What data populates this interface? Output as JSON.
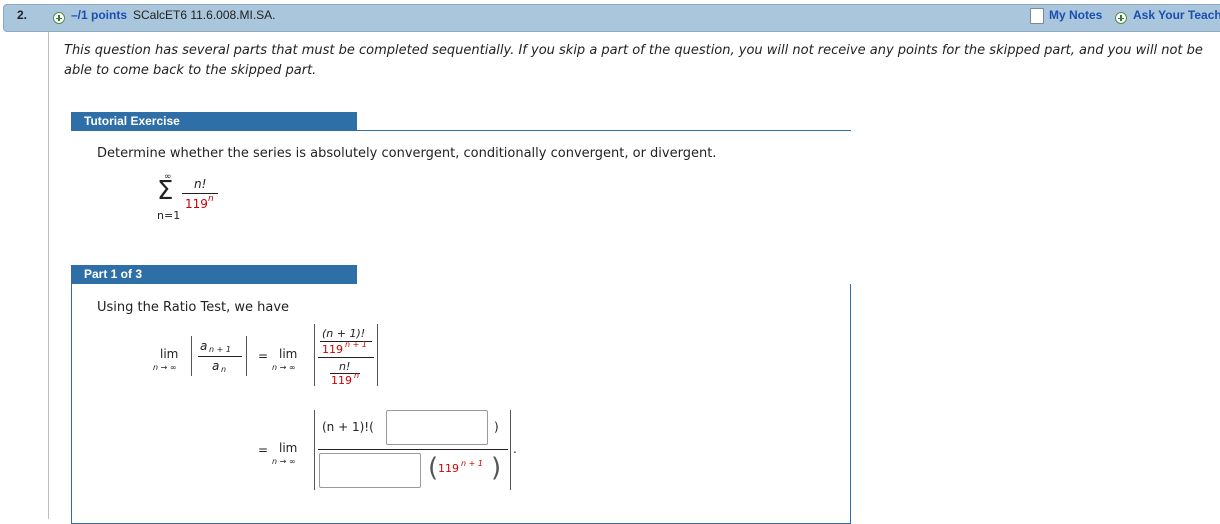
{
  "header": {
    "number": "2.",
    "points": "–/1 points",
    "question_id": "SCalcET6 11.6.008.MI.SA.",
    "my_notes": "My Notes",
    "ask_teacher": "Ask Your Teacher"
  },
  "intro": "This question has several parts that must be completed sequentially. If you skip a part of the question, you will not receive any points for the skipped part, and you will not be able to come back to the skipped part.",
  "tutorial": {
    "tab": "Tutorial Exercise",
    "prompt": "Determine whether the series is absolutely convergent, conditionally convergent, or divergent.",
    "series": {
      "upper": "∞",
      "sigma": "Σ",
      "lower": "n=1",
      "numerator": "n!",
      "denominator_base": "119",
      "denominator_exp": "n"
    }
  },
  "part1": {
    "tab": "Part 1 of 3",
    "text": "Using the Ratio Test, we have",
    "lim": "lim",
    "lim_sub": "n → ∞",
    "a_num": "a",
    "a_num_sub": "n + 1",
    "a_den": "a",
    "a_den_sub": "n",
    "eq": "=",
    "big_num_top": "(n + 1)!",
    "big_num_bot_base": "119",
    "big_num_bot_exp": "n + 1",
    "big_den_top": "n!",
    "big_den_bot_base": "119",
    "big_den_bot_exp": "n",
    "line3_num_left": "(n + 1)!(",
    "line3_num_right": ")",
    "line3_den_base": "119",
    "line3_den_exp": "n + 1",
    "period": "."
  }
}
